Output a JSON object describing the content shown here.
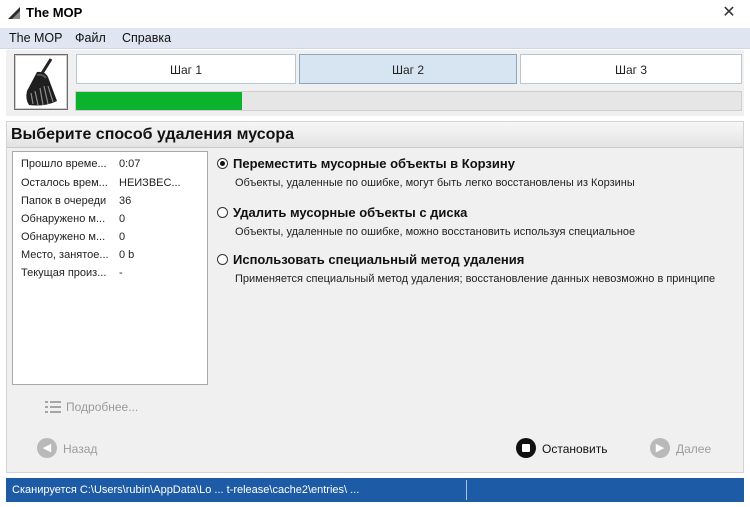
{
  "window": {
    "title": "The MOP",
    "close_glyph": "✕",
    "app_icon": "broom-icon"
  },
  "menu": {
    "items": [
      "The MOP",
      "Файл",
      "Справка"
    ]
  },
  "wizard": {
    "logo_icon": "broom-icon",
    "steps": [
      {
        "label": "Шаг 1",
        "active": false
      },
      {
        "label": "Шаг 2",
        "active": true
      },
      {
        "label": "Шаг 3",
        "active": false
      }
    ],
    "progress_fraction": 0.25,
    "progress_color": "#0ab22e"
  },
  "panel": {
    "heading": "Выберите способ удаления мусора",
    "stats": [
      {
        "label": "Прошло време...",
        "value": "0:07"
      },
      {
        "label": "Осталось врем...",
        "value": "НЕИЗВЕС..."
      },
      {
        "label": "Папок в очереди",
        "value": "36"
      },
      {
        "label": "Обнаружено м...",
        "value": "0"
      },
      {
        "label": "Обнаружено м...",
        "value": "0"
      },
      {
        "label": "Место, занятое...",
        "value": "0 b"
      },
      {
        "label": "Текущая произ...",
        "value": "-"
      }
    ],
    "options": [
      {
        "title": "Переместить мусорные объекты в Корзину",
        "desc": "Объекты, удаленные по ошибке, могут быть легко восстановлены из Корзины",
        "checked": true
      },
      {
        "title": "Удалить мусорные объекты с диска",
        "desc": "Объекты, удаленные по ошибке, можно восстановить используя специальное",
        "checked": false
      },
      {
        "title": "Использовать специальный метод удаления",
        "desc": "Применяется специальный метод удаления; восстановление данных невозможно в принципе",
        "checked": false
      }
    ],
    "details_label": "Подробнее..."
  },
  "nav": {
    "back_label": "Назад",
    "stop_label": "Остановить",
    "next_label": "Далее"
  },
  "status": {
    "text": "Сканируется C:\\Users\\rubin\\AppData\\Lo ... t-release\\cache2\\entries\\ ...",
    "bar_color": "#1e5ba6"
  }
}
